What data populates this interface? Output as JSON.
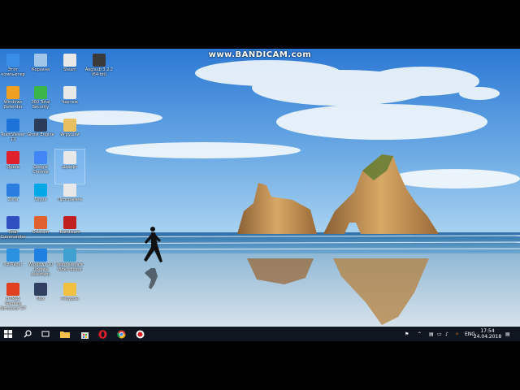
{
  "watermark": "www.BANDICAM.com",
  "desktop_icons": [
    {
      "label": "Этот компьютер",
      "icon": "computer-icon",
      "color": "#3a8ee6"
    },
    {
      "label": "Корзина",
      "icon": "recycle-bin-icon",
      "color": "#9fc6e8"
    },
    {
      "label": "Steam",
      "icon": "file-icon",
      "color": "#e8e8e8"
    },
    {
      "label": "Aegisub 3.2.2 (64-bit)",
      "icon": "app-icon",
      "color": "#3a3a3a"
    },
    {
      "label": "Windows Defender",
      "icon": "shield-icon",
      "color": "#f0a020"
    },
    {
      "label": "360 Total Security",
      "icon": "security-icon",
      "color": "#39b54a"
    },
    {
      "label": "Чертеж",
      "icon": "file-icon",
      "color": "#e8e8e8"
    },
    {
      "label": "TeamViewer 13",
      "icon": "teamviewer-icon",
      "color": "#1e73d8"
    },
    {
      "label": "Ghost Engine",
      "icon": "engine-icon",
      "color": "#2a3c5a"
    },
    {
      "label": "Игрушки",
      "icon": "folder-icon",
      "color": "#e8c060"
    },
    {
      "label": "Opera",
      "icon": "opera-icon",
      "color": "#e0202a"
    },
    {
      "label": "Google Chrome",
      "icon": "chrome-icon",
      "color": "#4285f4"
    },
    {
      "label": "Шрифт",
      "icon": "file-icon",
      "color": "#e8e8e8"
    },
    {
      "label": "Zona",
      "icon": "zona-icon",
      "color": "#2a7ee0"
    },
    {
      "label": "Skype",
      "icon": "skype-icon",
      "color": "#00a8e8"
    },
    {
      "label": "Программа",
      "icon": "file-icon",
      "color": "#e8e8e8"
    },
    {
      "label": "Total Commander",
      "icon": "floppy-icon",
      "color": "#3050c0"
    },
    {
      "label": "Orbitum",
      "icon": "orbitum-icon",
      "color": "#e06030"
    },
    {
      "label": "Bandicam",
      "icon": "bandicam-icon",
      "color": "#c02020"
    },
    {
      "label": "PotPlayer",
      "icon": "potplayer-icon",
      "color": "#2a90e0"
    },
    {
      "label": "Windows 10 Update Assistant",
      "icon": "windows-icon",
      "color": "#1e80e0"
    },
    {
      "label": "Wondershare Video Editor",
      "icon": "editor-icon",
      "color": "#40a0d0"
    },
    {
      "label": "HTML5 Gaming Simulator 97",
      "icon": "html5-icon",
      "color": "#e04020"
    },
    {
      "label": "Nox",
      "icon": "nox-icon",
      "color": "#304060"
    },
    {
      "label": "Ресурсы",
      "icon": "resources-icon",
      "color": "#f0c040"
    }
  ],
  "taskbar": {
    "apps": [
      {
        "name": "start-button",
        "icon": "windows-start-icon"
      },
      {
        "name": "search-button",
        "icon": "search-icon"
      },
      {
        "name": "task-view-button",
        "icon": "task-view-icon"
      },
      {
        "name": "explorer-taskbar",
        "icon": "folder-icon"
      },
      {
        "name": "store-taskbar",
        "icon": "store-icon"
      },
      {
        "name": "opera-taskbar",
        "icon": "opera-icon"
      },
      {
        "name": "chrome-taskbar",
        "icon": "chrome-icon"
      },
      {
        "name": "bandicam-taskbar",
        "icon": "bandicam-icon"
      }
    ],
    "language": "ENG",
    "time": "17:54",
    "date": "24.04.2018"
  },
  "colors": {
    "taskbar": "#0f1620",
    "sky_top": "#2f7fd8",
    "sky_bottom": "#8ec3ee",
    "sea": "#3c8fc8",
    "sand": "#b9c8d6",
    "rock": "#b68a55"
  }
}
